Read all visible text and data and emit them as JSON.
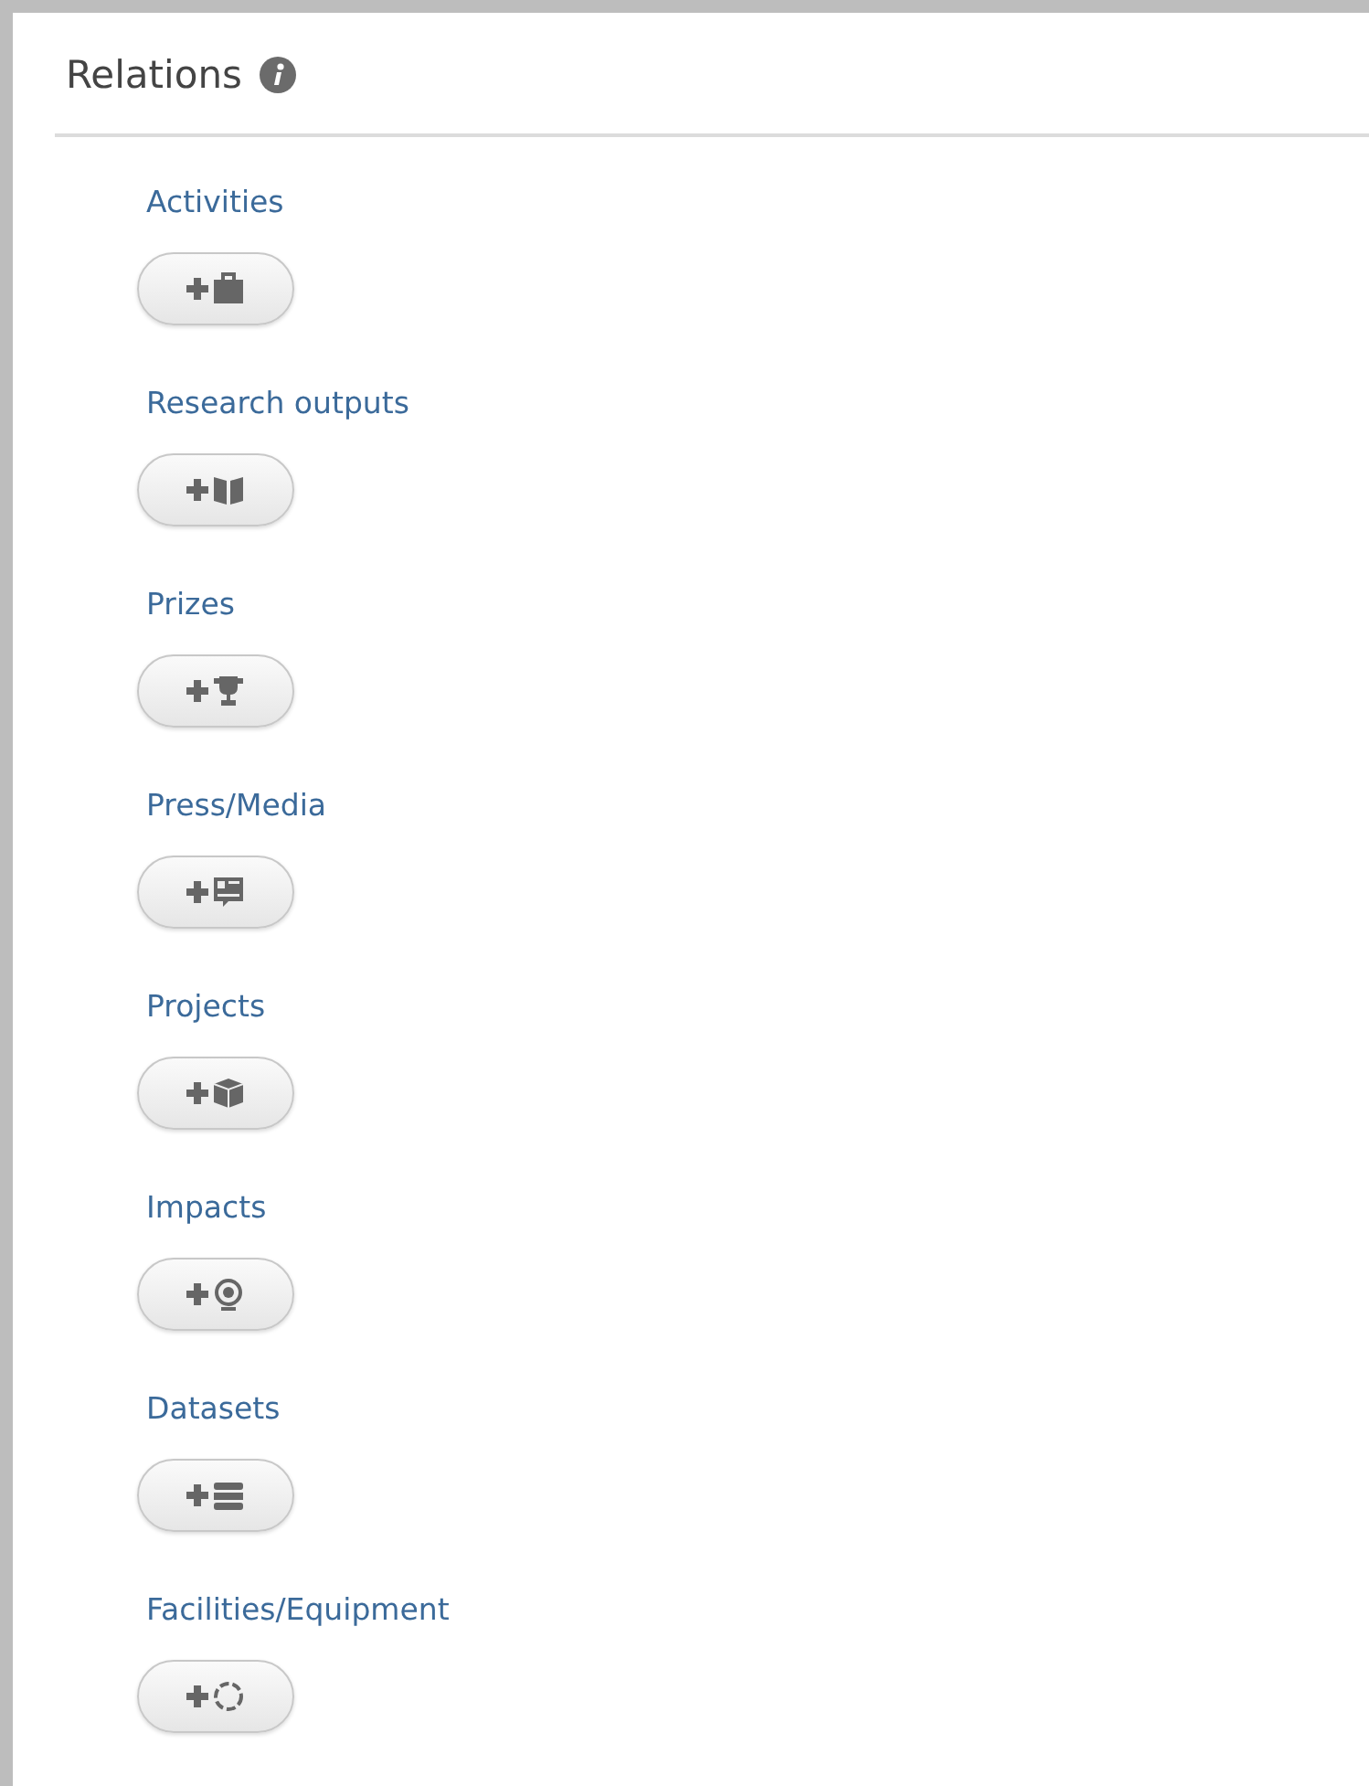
{
  "panel": {
    "title": "Relations"
  },
  "relations": [
    {
      "label": "Activities",
      "kind": "briefcase"
    },
    {
      "label": "Research outputs",
      "kind": "book"
    },
    {
      "label": "Prizes",
      "kind": "trophy"
    },
    {
      "label": "Press/Media",
      "kind": "newspaper"
    },
    {
      "label": "Projects",
      "kind": "cube"
    },
    {
      "label": "Impacts",
      "kind": "target"
    },
    {
      "label": "Datasets",
      "kind": "database"
    },
    {
      "label": "Facilities/Equipment",
      "kind": "ring"
    }
  ]
}
